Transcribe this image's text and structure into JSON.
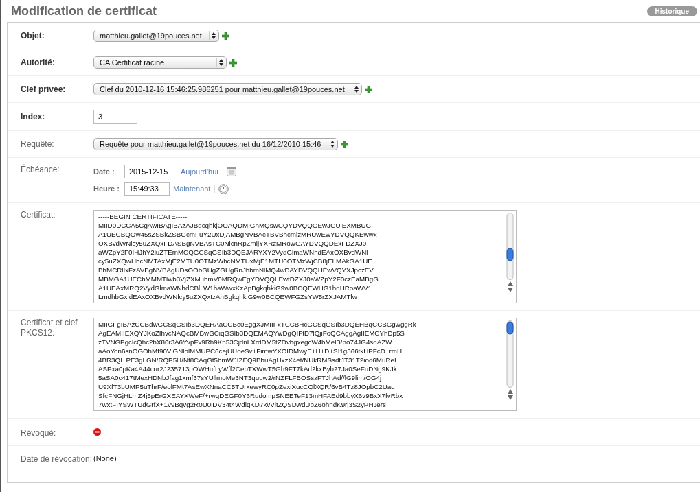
{
  "page": {
    "title": "Modification de certificat",
    "history_button": "Historique"
  },
  "fields": [
    {
      "label": "Objet:",
      "required": true,
      "kind": "select",
      "value": "matthieu.gallet@19pouces.net",
      "addable": true
    },
    {
      "label": "Autorité:",
      "required": true,
      "kind": "select",
      "value": "CA Certificat racine",
      "addable": true,
      "wide": true
    },
    {
      "label": "Clef privée:",
      "required": true,
      "kind": "select",
      "value": "Clef du 2010-12-16 15:46:25.986251 pour matthieu.gallet@19pouces.net",
      "addable": true
    },
    {
      "label": "Index:",
      "required": true,
      "kind": "text",
      "value": "3"
    },
    {
      "label": "Requête:",
      "required": false,
      "kind": "select",
      "value": "Requête pour matthieu.gallet@19pouces.net du 16/12/2010 15:46",
      "addable": true
    },
    {
      "label": "Échéance:",
      "required": false,
      "kind": "datetime",
      "date_label": "Date :",
      "date": "2015-12-15",
      "today_link": "Aujourd'hui",
      "time_label": "Heure :",
      "time": "15:49:33",
      "now_link": "Maintenant"
    },
    {
      "label": "Certificat:",
      "required": false,
      "kind": "textarea",
      "lines": [
        "-----BEGIN CERTIFICATE-----",
        "MIID0DCCA5CgAwIBAgIBAzAJBgcqhkjOOAQDMIGnMQswCQYDVQQGEwJGUjEXMBUG",
        "A1UECBQOw45sZSBkZSBGcmFuY2UxDjAMBgNVBAcTBVBhcmlzMRUwEwYDVQQKEwwx",
        "OXBvdWNlcy5uZXQxFDASBgNVBAsTC0NlcnRpZmljYXRzMRowGAYDVQQDExFDZXJ0",
        "aWZpY2F0IHJhY2luZTEmMCQGCSqGSIb3DQEJARYXY2VydGlmaWNhdEAxOXBvdWNl",
        "cy5uZXQwHhcNMTAxMjE2MTU0OTMzWhcNMTUxMjE1MTU0OTMzWjCB8jELMAkGA1UE",
        "BhMCRlIxFzAVBgNVBAgUDsOObGUgZGUgRnJhbmNlMQ4wDAYDVQQHEwVQYXJpczEV",
        "MBMGA1UEChMMMTlwb3VjZXMubmV0MRQwEgYDVQQLEwtDZXJ0aWZpY2F0czEaMBgG",
        "A1UEAxMRQ2VydGlmaWNhdCBlLW1haWwxKzApBgkqhkiG9w0BCQEWHG1hdHRoaWV1",
        "LmdhbGxldEAxOXBvdWNlcy5uZXQxIzAhBgkqhkiG9w0BCQEWFGZsYW5rZXJAMTlw"
      ]
    },
    {
      "label": "Certificat et clef PKCS12:",
      "required": false,
      "kind": "textarea",
      "lines": [
        "MIIGFgIBAzCCBdwGCSqGSIb3DQEHAaCCBc0EggXJMIIFxTCCBHcGCSqGSIb3DQEHBqCCBGgwggRk",
        "AgEAMIIEXQYJKoZIhvcNAQcBMBwGCiqGSIb3DQEMAQYwDgQIFtD7lQjiFoQCAggAgIIEMCYhDp5S",
        "zTVNGPgclcQhc2hX80r3A6YvpFv9Rh9Kn53CjdnLXrdDM5tZDvbgxegcW4bMelB/po74JG4sqAZW",
        "aAoYon6snOGOhMf90VlGNlolMMUPC6cejUUoeSv+FimwYXOIDMwyE+H+D+SI1g366tkHPFcD+rmH",
        "4BR3QI+PE3gLGN/RQP5H/Nf8CAqGf5bmWJIZEQ9BbuAgHxzX4et/NUkRMSsdtJT31T2iod6MuReI",
        "ASPxa0pKa4A44cur2J235713pOWHufLyWff2CebTXWwT5Gh9FT7kAd2kxByb27Ja0SeFuDNg9KJk",
        "5aSA0c417tMexHDNbJfag1xmf37sYUllmoMe3NT3quuw2/rNZFLFBOSszFTJhAd//lG9lim/OG4j",
        "U9XfT3bUMP5uThrF/eolFMt7AsEwXNnaCC5TUrxewyRC0pZexiXucCQlXQR/6vB4Tz8JOpbC2Uaq",
        "SfcFNGjHLmZ4j5pErGXEAYXWeF/+rwqDEGF0Y6RudompSNEETeF13mHFAEd9bbyX6v9BxX7fvRbx",
        "7wxtFIYSWTUdGrfX+1v9Bqvg2R0U0iDV34t4WdlqKD7kvVltZQSDwdUbZ6ohndK9rj3S2yPHJers"
      ]
    },
    {
      "label": "Révoqué:",
      "required": false,
      "kind": "boolean",
      "value": false
    },
    {
      "label": "Date de révocation:",
      "required": false,
      "kind": "readonly",
      "value": "(None)"
    }
  ]
}
